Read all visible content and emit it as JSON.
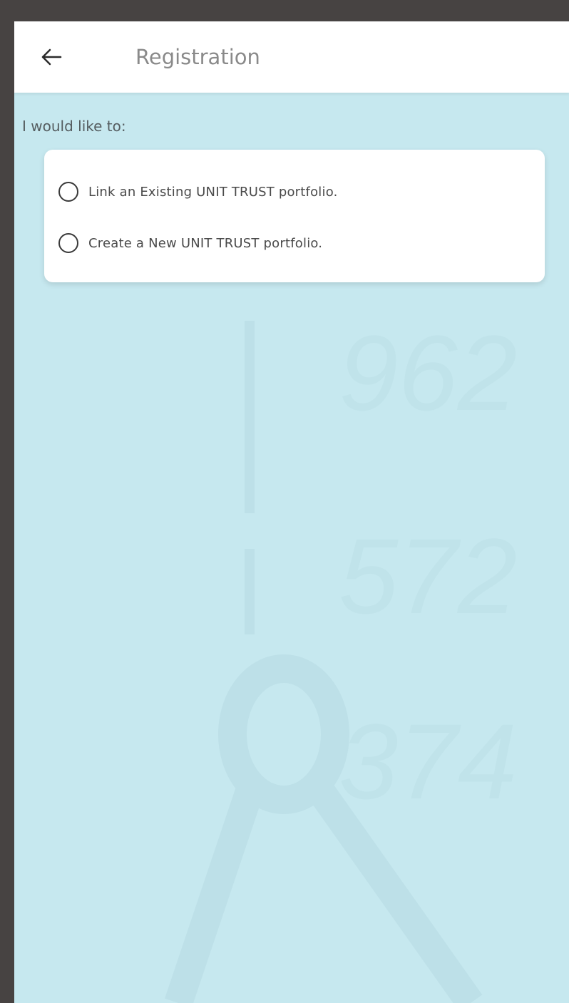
{
  "header": {
    "title": "Registration",
    "back_icon": "arrow-left-icon"
  },
  "prompt": "I would like to:",
  "options": [
    {
      "label": "Link an Existing UNIT TRUST portfolio.",
      "selected": false
    },
    {
      "label": "Create a New UNIT TRUST portfolio.",
      "selected": false
    }
  ],
  "colors": {
    "background": "#c6e8ef",
    "app_bar": "#ffffff",
    "frame": "#474342"
  }
}
